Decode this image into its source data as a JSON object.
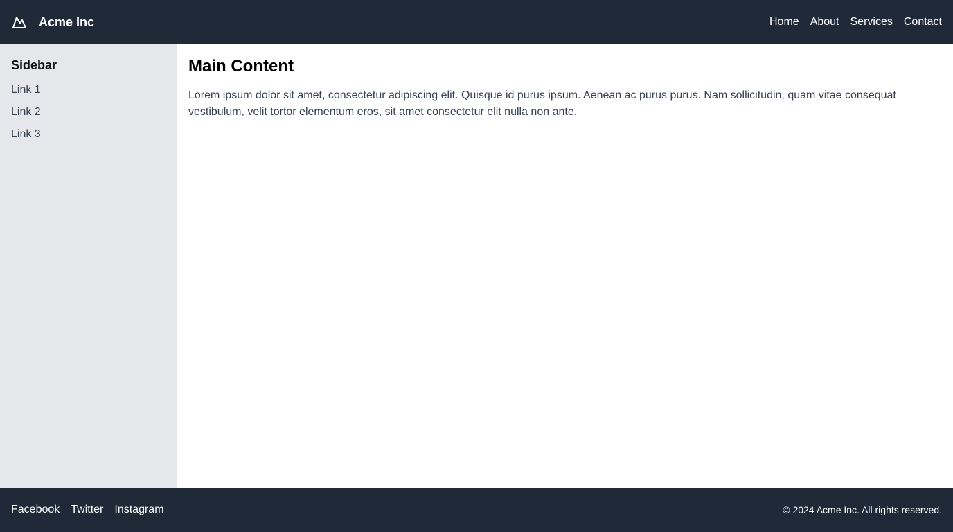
{
  "colors": {
    "header_bg": "#1f2937",
    "sidebar_bg": "#e5e7eb",
    "content_bg": "#ffffff",
    "text_muted": "#374151"
  },
  "header": {
    "logo_icon": "mountain-icon",
    "brand": "Acme Inc",
    "nav": {
      "home": "Home",
      "about": "About",
      "services": "Services",
      "contact": "Contact"
    }
  },
  "sidebar": {
    "title": "Sidebar",
    "links": [
      "Link 1",
      "Link 2",
      "Link 3"
    ]
  },
  "main": {
    "title": "Main Content",
    "paragraph": "Lorem ipsum dolor sit amet, consectetur adipiscing elit. Quisque id purus ipsum. Aenean ac purus purus. Nam sollicitudin, quam vitae consequat vestibulum, velit tortor elementum eros, sit amet consectetur elit nulla non ante."
  },
  "footer": {
    "social": {
      "facebook": "Facebook",
      "twitter": "Twitter",
      "instagram": "Instagram"
    },
    "copyright": "© 2024 Acme Inc. All rights reserved."
  }
}
